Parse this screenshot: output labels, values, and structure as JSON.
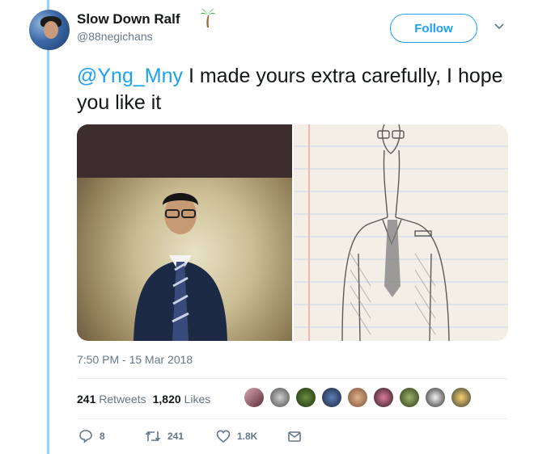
{
  "tweet": {
    "display_name": "Slow Down Ralf",
    "name_emoji": "palm-tree",
    "handle": "@88negichans",
    "follow_label": "Follow",
    "mention": "@Yng_Mny",
    "text": " I made yours extra carefully, I hope you like it",
    "timestamp": "7:50 PM - 15 Mar 2018",
    "retweets_count": "241",
    "retweets_label": "Retweets",
    "likes_count": "1,820",
    "likes_label": "Likes",
    "actions": {
      "reply_count": "8",
      "retweet_count": "241",
      "like_count": "1.8K"
    }
  },
  "colors": {
    "accent": "#1da1f2",
    "thread_line": "#9ad2f6",
    "muted_text": "#657786"
  }
}
